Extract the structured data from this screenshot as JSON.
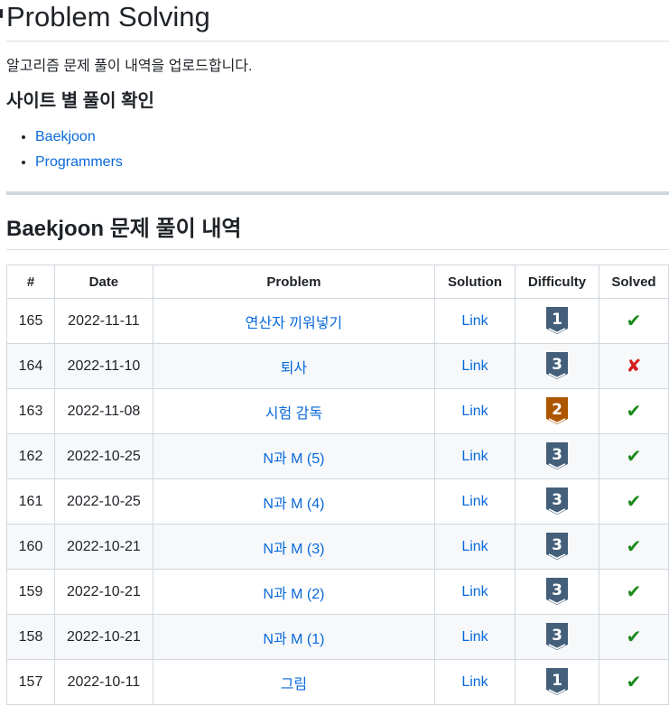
{
  "header": {
    "title": "Problem Solving",
    "intro": "알고리즘 문제 풀이 내역을 업로드합니다."
  },
  "sites": {
    "heading": "사이트 별 풀이 확인",
    "links": [
      "Baekjoon",
      "Programmers"
    ]
  },
  "section": {
    "title": "Baekjoon 문제 풀이 내역"
  },
  "table": {
    "headers": {
      "num": "#",
      "date": "Date",
      "problem": "Problem",
      "solution": "Solution",
      "difficulty": "Difficulty",
      "solved": "Solved"
    },
    "rows": [
      {
        "num": "165",
        "date": "2022-11-11",
        "problem": "연산자 끼워넣기",
        "solution": "Link",
        "tier": "silver",
        "level": "1",
        "solved": true
      },
      {
        "num": "164",
        "date": "2022-11-10",
        "problem": "퇴사",
        "solution": "Link",
        "tier": "silver",
        "level": "3",
        "solved": false
      },
      {
        "num": "163",
        "date": "2022-11-08",
        "problem": "시험 감독",
        "solution": "Link",
        "tier": "bronze",
        "level": "2",
        "solved": true
      },
      {
        "num": "162",
        "date": "2022-10-25",
        "problem": "N과 M (5)",
        "solution": "Link",
        "tier": "silver",
        "level": "3",
        "solved": true
      },
      {
        "num": "161",
        "date": "2022-10-25",
        "problem": "N과 M (4)",
        "solution": "Link",
        "tier": "silver",
        "level": "3",
        "solved": true
      },
      {
        "num": "160",
        "date": "2022-10-21",
        "problem": "N과 M (3)",
        "solution": "Link",
        "tier": "silver",
        "level": "3",
        "solved": true
      },
      {
        "num": "159",
        "date": "2022-10-21",
        "problem": "N과 M (2)",
        "solution": "Link",
        "tier": "silver",
        "level": "3",
        "solved": true
      },
      {
        "num": "158",
        "date": "2022-10-21",
        "problem": "N과 M (1)",
        "solution": "Link",
        "tier": "silver",
        "level": "3",
        "solved": true
      },
      {
        "num": "157",
        "date": "2022-10-11",
        "problem": "그림",
        "solution": "Link",
        "tier": "silver",
        "level": "1",
        "solved": true
      }
    ]
  },
  "icons": {
    "solved_yes": "✔",
    "solved_no": "✘"
  },
  "colors": {
    "link": "#0969da",
    "silver_tier": "#435f7a",
    "bronze_tier": "#ad5600",
    "solved_yes": "#1a8a1a",
    "solved_no": "#d42020"
  }
}
